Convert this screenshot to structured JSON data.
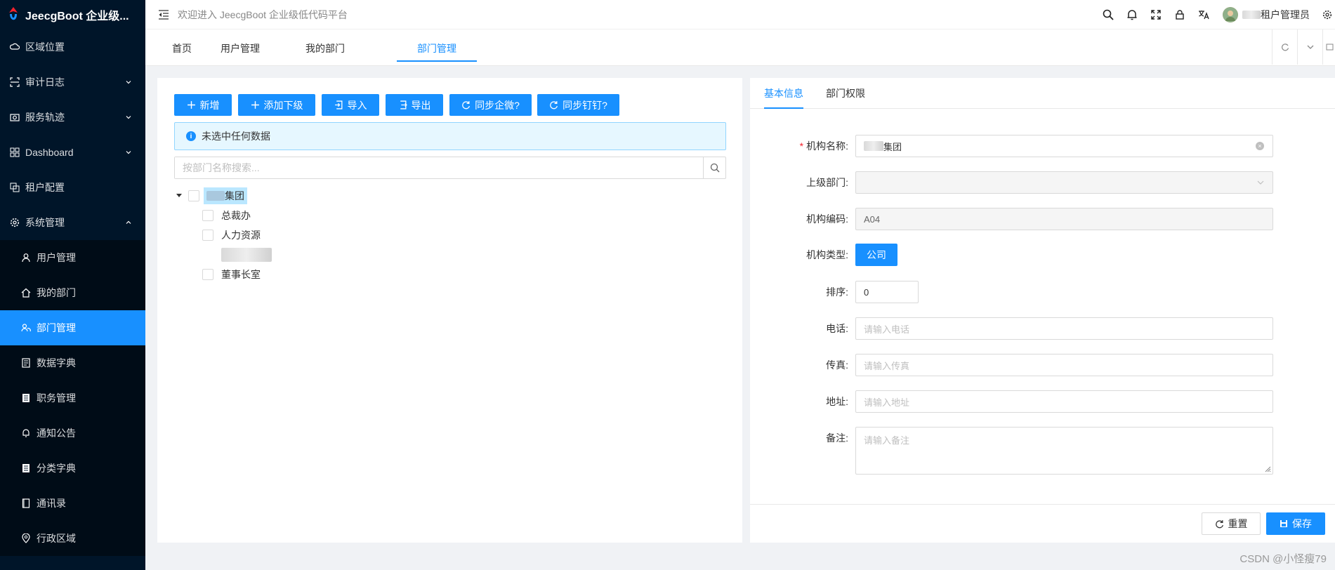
{
  "app": {
    "title": "JeecgBoot 企业级...",
    "welcome": "欢迎进入 JeecgBoot 企业级低代码平台",
    "user_role": "租户管理员"
  },
  "sidebar": {
    "items": [
      {
        "label": "区域位置",
        "icon": "cloud-icon"
      },
      {
        "label": "审计日志",
        "icon": "scan-icon"
      },
      {
        "label": "服务轨迹",
        "icon": "camera-icon"
      },
      {
        "label": "Dashboard",
        "icon": "grid-icon"
      },
      {
        "label": "租户配置",
        "icon": "copy-icon"
      },
      {
        "label": "系统管理",
        "icon": "gear-icon"
      }
    ],
    "sub_items": [
      {
        "label": "用户管理",
        "icon": "user-icon"
      },
      {
        "label": "我的部门",
        "icon": "home-icon"
      },
      {
        "label": "部门管理",
        "icon": "team-icon"
      },
      {
        "label": "数据字典",
        "icon": "book-icon"
      },
      {
        "label": "职务管理",
        "icon": "table-icon"
      },
      {
        "label": "通知公告",
        "icon": "bell-icon"
      },
      {
        "label": "分类字典",
        "icon": "list-icon"
      },
      {
        "label": "通讯录",
        "icon": "contacts-icon"
      },
      {
        "label": "行政区域",
        "icon": "location-icon"
      }
    ]
  },
  "tabs": [
    {
      "label": "首页"
    },
    {
      "label": "用户管理"
    },
    {
      "label": "我的部门"
    },
    {
      "label": "部门管理"
    }
  ],
  "toolbar": {
    "add": "新增",
    "add_child": "添加下级",
    "import": "导入",
    "export": "导出",
    "sync_wecom": "同步企微?",
    "sync_dingtalk": "同步钉钉?"
  },
  "alert": {
    "text": "未选中任何数据"
  },
  "search": {
    "placeholder": "按部门名称搜索..."
  },
  "tree": {
    "root": "集团",
    "children": [
      "总裁办",
      "人力资源",
      "",
      "董事长室"
    ]
  },
  "detail": {
    "tabs": [
      "基本信息",
      "部门权限"
    ],
    "labels": {
      "name": "机构名称:",
      "parent": "上级部门:",
      "code": "机构编码:",
      "type": "机构类型:",
      "order": "排序:",
      "phone": "电话:",
      "fax": "传真:",
      "address": "地址:",
      "remark": "备注:"
    },
    "values": {
      "name": "集团",
      "code": "A04",
      "type": "公司",
      "order": "0"
    },
    "placeholders": {
      "phone": "请输入电话",
      "fax": "请输入传真",
      "address": "请输入地址",
      "remark": "请输入备注"
    },
    "reset": "重置",
    "save": "保存"
  },
  "watermark": "CSDN @小怪瘦79",
  "colors": {
    "primary": "#1890ff",
    "sidebar_bg": "#001529"
  }
}
